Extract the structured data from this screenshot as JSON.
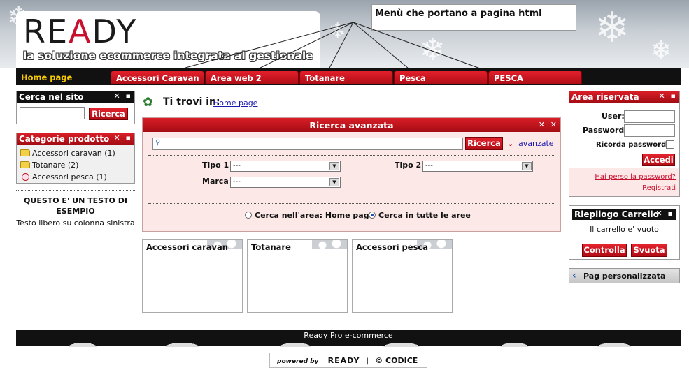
{
  "header": {
    "logo": "READY",
    "tagline": "la soluzione ecommerce integrata al gestionale",
    "annotation": "Menù che portano a pagina html"
  },
  "nav": {
    "items": [
      {
        "label": "Home page",
        "active": true
      },
      {
        "label": "Accessori Caravan",
        "active": false
      },
      {
        "label": "Area web 2",
        "active": false
      },
      {
        "label": "Totanare",
        "active": false
      },
      {
        "label": "Pesca",
        "active": false
      },
      {
        "label": "PESCA",
        "active": false
      }
    ]
  },
  "left": {
    "search": {
      "title": "Cerca nel sito",
      "button": "Ricerca",
      "value": ""
    },
    "categories": {
      "title": "Categorie prodotto",
      "items": [
        {
          "label": "Accessori caravan (1)",
          "icon": "folder-icon"
        },
        {
          "label": "Totanare (2)",
          "icon": "folder-icon"
        },
        {
          "label": "Accessori pesca (1)",
          "icon": "round-icon"
        }
      ]
    },
    "free_text": {
      "title": "QUESTO E' UN TESTO DI ESEMPIO",
      "body": "Testo libero su colonna sinistra"
    }
  },
  "main": {
    "breadcrumb": {
      "label": "Ti trovi in:",
      "link": "Home page"
    },
    "advanced_search": {
      "title": "Ricerca avanzata",
      "button": "Ricerca",
      "advanced_link": "avanzate",
      "fields": {
        "tipo1": {
          "label": "Tipo 1",
          "value": "---"
        },
        "tipo2": {
          "label": "Tipo 2",
          "value": "---"
        },
        "marca": {
          "label": "Marca",
          "value": "---"
        }
      },
      "scope": {
        "option1": "Cerca nell'area: Home page",
        "option2": "Cerca in tutte le aree",
        "selected": "option2"
      }
    },
    "category_cards": [
      "Accessori caravan",
      "Totanare",
      "Accessori pesca"
    ]
  },
  "right": {
    "login": {
      "title": "Area riservata",
      "user_label": "User:",
      "password_label": "Password:",
      "remember_label": "Ricorda password",
      "button": "Accedi",
      "forgot_link": "Hai perso la password?",
      "register_link": "Registrati"
    },
    "cart": {
      "title": "Riepilogo Carrello",
      "empty_text": "Il carrello e' vuoto",
      "check_button": "Controlla",
      "empty_button": "Svuota"
    },
    "custom_page": {
      "label": "Pag personalizzata"
    }
  },
  "footer": {
    "text": "Ready Pro e-commerce",
    "powered_by": "powered by",
    "brand1": "READY",
    "brand2": "© CODICE"
  },
  "colors": {
    "accent": "#c8102e",
    "active_nav": "#f6c800"
  }
}
